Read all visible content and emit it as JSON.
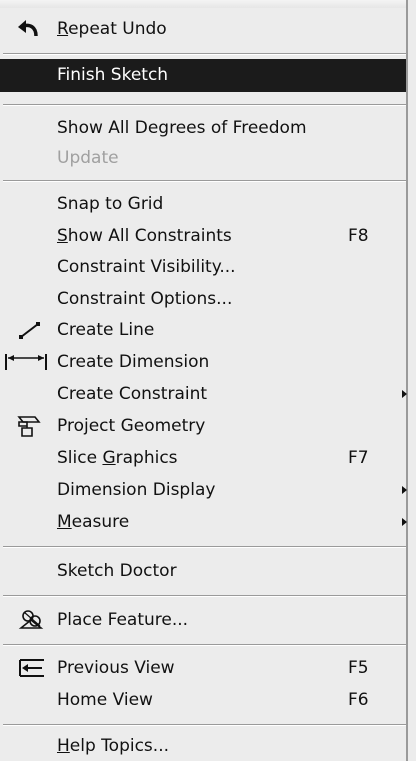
{
  "menu": {
    "items": [
      {
        "mnemonic": "R",
        "rest": "epeat Undo",
        "shortcut": "",
        "icon": "undo-arrow-icon"
      },
      {
        "label": "Finish Sketch",
        "shortcut": ""
      },
      {
        "label": "Show All Degrees of Freedom",
        "shortcut": ""
      },
      {
        "label": "Update",
        "shortcut": "",
        "disabled": true
      },
      {
        "label": "Snap to Grid",
        "shortcut": ""
      },
      {
        "mnemonic": "S",
        "rest": "how All Constraints",
        "shortcut": "F8"
      },
      {
        "label": "Constraint Visibility...",
        "shortcut": ""
      },
      {
        "label": "Constraint Options...",
        "shortcut": ""
      },
      {
        "label": "Create Line",
        "shortcut": "",
        "icon": "line-icon"
      },
      {
        "label": "Create Dimension",
        "shortcut": "",
        "icon": "dimension-icon"
      },
      {
        "label": "Create Constraint",
        "shortcut": "",
        "submenu": true
      },
      {
        "label": "Project Geometry",
        "shortcut": "",
        "icon": "project-geometry-icon"
      },
      {
        "pre": "Slice ",
        "mnemonic": "G",
        "rest": "raphics",
        "shortcut": "F7"
      },
      {
        "label": "Dimension Display",
        "shortcut": "",
        "submenu": true
      },
      {
        "mnemonic": "M",
        "rest": "easure",
        "shortcut": "",
        "submenu": true
      },
      {
        "label": "Sketch Doctor",
        "shortcut": ""
      },
      {
        "label": "Place Feature...",
        "shortcut": "",
        "icon": "place-feature-icon"
      },
      {
        "label": "Previous View",
        "shortcut": "F5",
        "icon": "previous-view-icon"
      },
      {
        "label": "Home View",
        "shortcut": "F6"
      },
      {
        "mnemonic": "H",
        "rest": "elp Topics...",
        "shortcut": ""
      }
    ]
  },
  "colors": {
    "menu_bg": "#ececec",
    "highlight_bg": "#1b1b1b",
    "highlight_text": "#ffffff",
    "disabled_text": "#a0a0a0"
  }
}
